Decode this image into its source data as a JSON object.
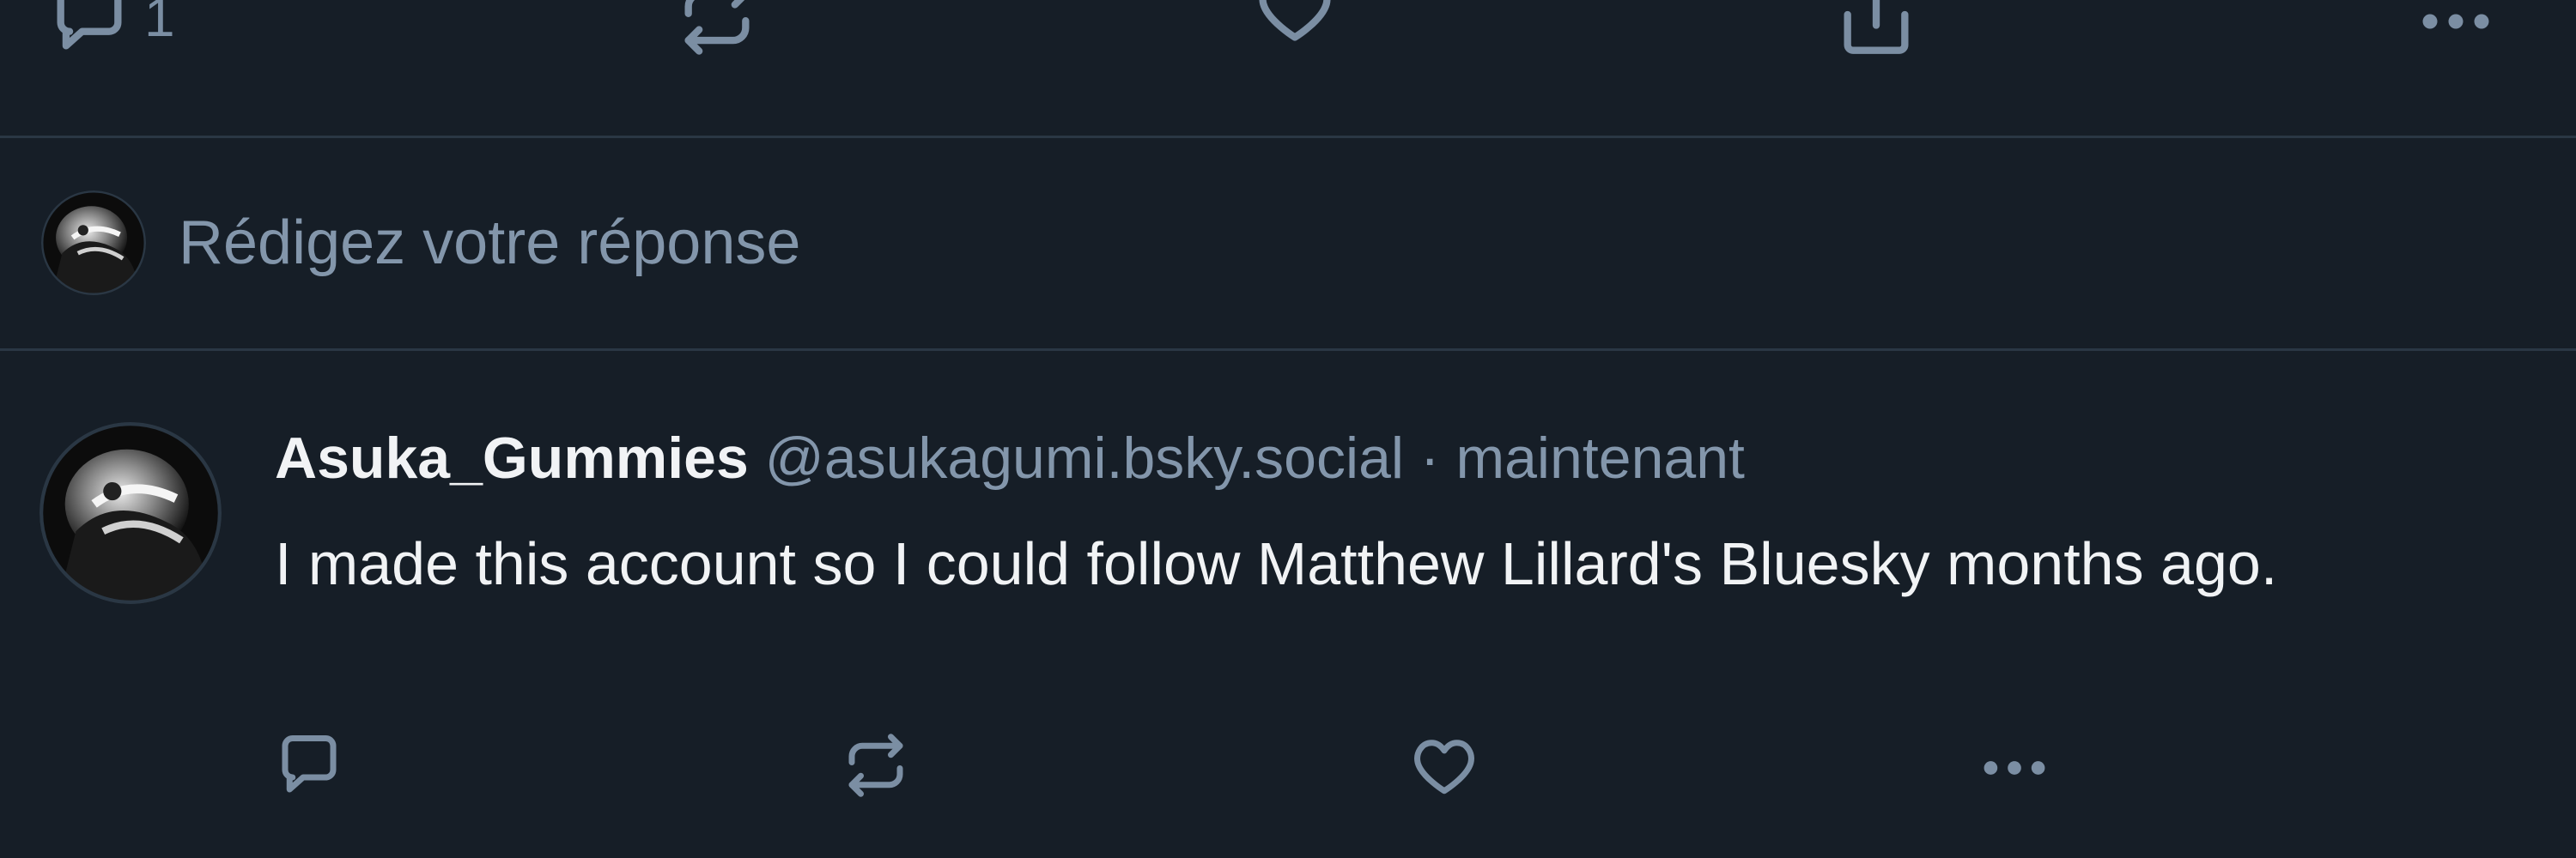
{
  "parent_post": {
    "actions": {
      "reply_count": "1"
    }
  },
  "composer": {
    "placeholder": "Rédigez votre réponse"
  },
  "reply_post": {
    "author_name": "Asuka_Gummies",
    "author_handle": "@asukagumi.bsky.social",
    "separator": "·",
    "timestamp": "maintenant",
    "text": "I made this account so I could follow Matthew Lillard's Bluesky months ago."
  },
  "colors": {
    "background": "#161e27",
    "divider": "#2a3744",
    "muted_text": "#8396ab",
    "icon": "#7b8ea3",
    "primary_text": "#f1f3f5"
  },
  "icons": [
    "reply-icon",
    "repost-icon",
    "like-icon",
    "share-icon",
    "more-icon",
    "avatar"
  ]
}
